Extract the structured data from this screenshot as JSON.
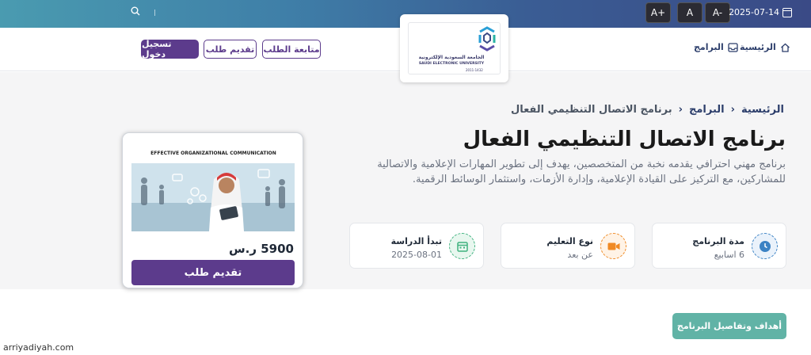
{
  "topbar": {
    "date": "2025-07-14",
    "font_buttons": [
      "A-",
      "A",
      "A+"
    ]
  },
  "header": {
    "nav": [
      {
        "label": "الرئيسية",
        "icon": "home-icon"
      },
      {
        "label": "البرامج",
        "icon": "inbox-icon"
      }
    ],
    "buttons": {
      "track": "متابعة الطلب",
      "apply": "تقديم طلب",
      "login": "تسجيل دخول"
    },
    "logo": {
      "name_ar": "الجامعة السعودية الإلكترونية",
      "name_en": "SAUDI ELECTRONIC UNIVERSITY",
      "years": "2011-1432"
    }
  },
  "breadcrumb": [
    "الرئيسية",
    "البرامج",
    "برنامج الاتصال التنظيمي الفعال"
  ],
  "program": {
    "title": "برنامج الاتصال التنظيمي الفعال",
    "description": "برنامج مهني احترافي يقدمه نخبة من المتخصصين، يهدف إلى تطوير المهارات الإعلامية والاتصالية للمشاركين، مع التركيز على القيادة الإعلامية، وإدارة الأزمات، واستثمار الوسائط الرقمية.",
    "image_title": "EFFECTIVE ORGANIZATIONAL COMMUNICATION",
    "price": "5900 ر.س",
    "apply_button": "تقديم طلب"
  },
  "info_cards": [
    {
      "label": "مدة البرنامج",
      "value": "6 اسابيع",
      "icon": "clock-icon",
      "color": "#3b82c4"
    },
    {
      "label": "نوع التعليم",
      "value": "عن بعد",
      "icon": "video-icon",
      "color": "#f08a24"
    },
    {
      "label": "تبدأ الدراسة",
      "value": "2025-08-01",
      "icon": "calendar-icon",
      "color": "#3fb27f"
    }
  ],
  "goals_button": "أهداف وتفاصيل البرنامج",
  "watermark": "arriyadiyah.com",
  "colors": {
    "primary": "#5c3b8c",
    "teal": "#61b3a6",
    "navy": "#2c3e6b"
  }
}
